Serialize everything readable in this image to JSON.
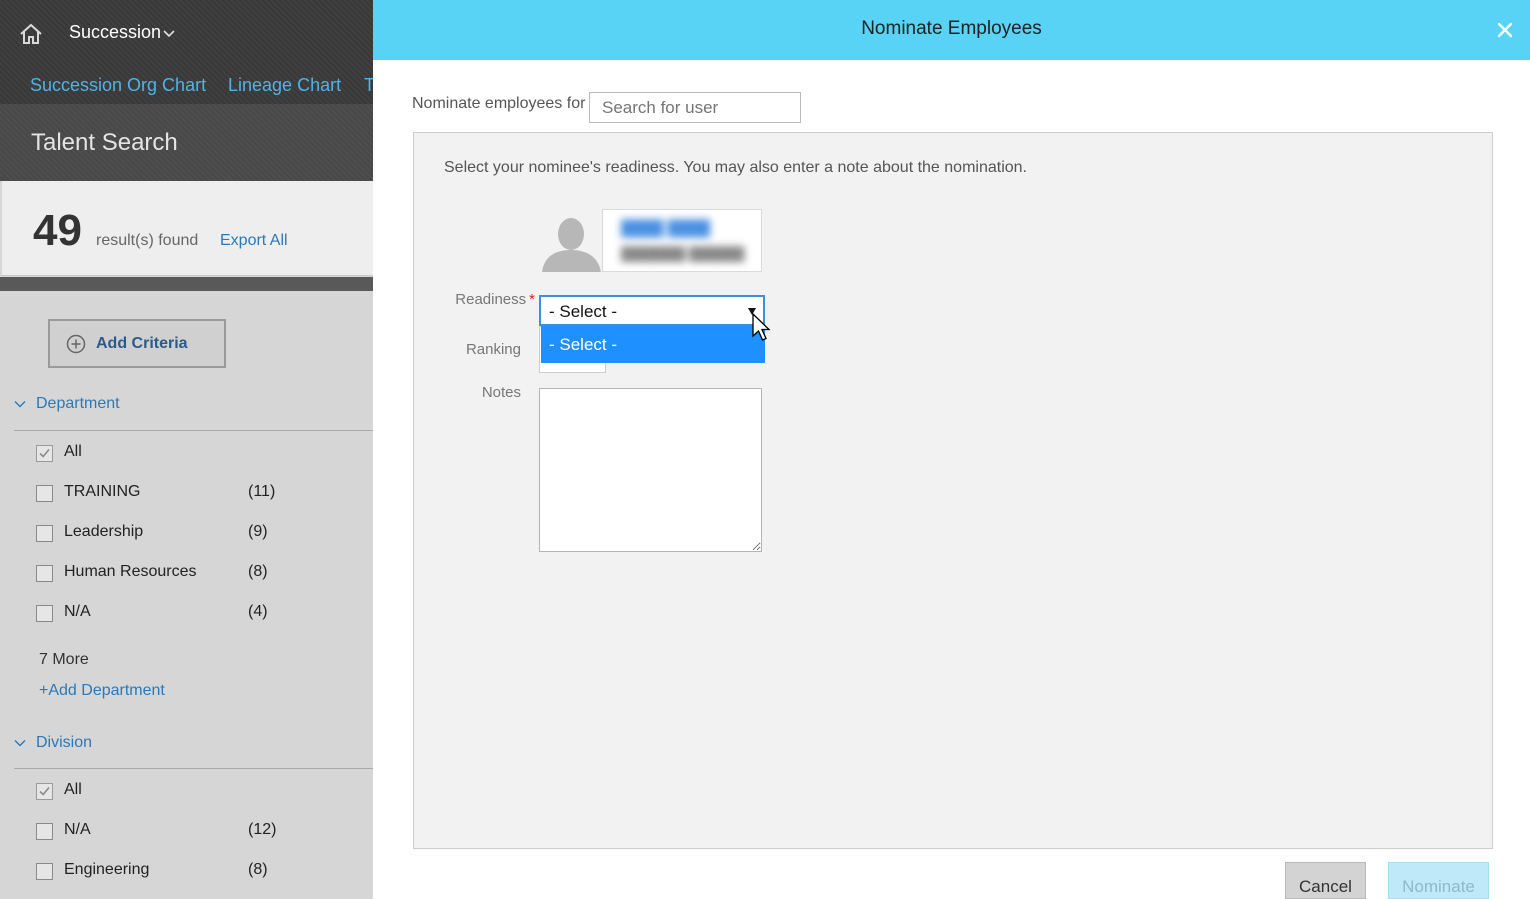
{
  "app": {
    "title": "Succession",
    "nav_links": [
      "Succession Org Chart",
      "Lineage Chart",
      "T"
    ]
  },
  "talent_search": {
    "title": "Talent Search",
    "results_count": "49",
    "results_label": "result(s) found",
    "export_label": "Export All",
    "add_criteria_label": "Add Criteria"
  },
  "filters": {
    "department": {
      "title": "Department",
      "items": [
        {
          "label": "All",
          "count": "",
          "checked": true
        },
        {
          "label": "TRAINING",
          "count": "(11)",
          "checked": false
        },
        {
          "label": "Leadership",
          "count": "(9)",
          "checked": false
        },
        {
          "label": "Human Resources",
          "count": "(8)",
          "checked": false
        },
        {
          "label": "N/A",
          "count": "(4)",
          "checked": false
        }
      ],
      "more_label": "7 More",
      "add_label": "+Add Department"
    },
    "division": {
      "title": "Division",
      "items": [
        {
          "label": "All",
          "count": "",
          "checked": true
        },
        {
          "label": "N/A",
          "count": "(12)",
          "checked": false
        },
        {
          "label": "Engineering",
          "count": "(8)",
          "checked": false
        }
      ]
    }
  },
  "dialog": {
    "title": "Nominate Employees",
    "nominate_for_label": "Nominate employees for",
    "search_placeholder": "Search for user",
    "instructions": "Select your nominee's readiness. You may also enter a note about the nomination.",
    "readiness_label": "Readiness",
    "required_marker": "*",
    "readiness_value": "- Select -",
    "readiness_options": [
      "- Select -"
    ],
    "ranking_label": "Ranking",
    "notes_label": "Notes",
    "cancel_label": "Cancel",
    "nominate_label": "Nominate"
  },
  "colors": {
    "header_accent": "#58d2f5",
    "link": "#2a79b8",
    "dropdown_highlight": "#1e90ff",
    "required": "#e02020"
  }
}
